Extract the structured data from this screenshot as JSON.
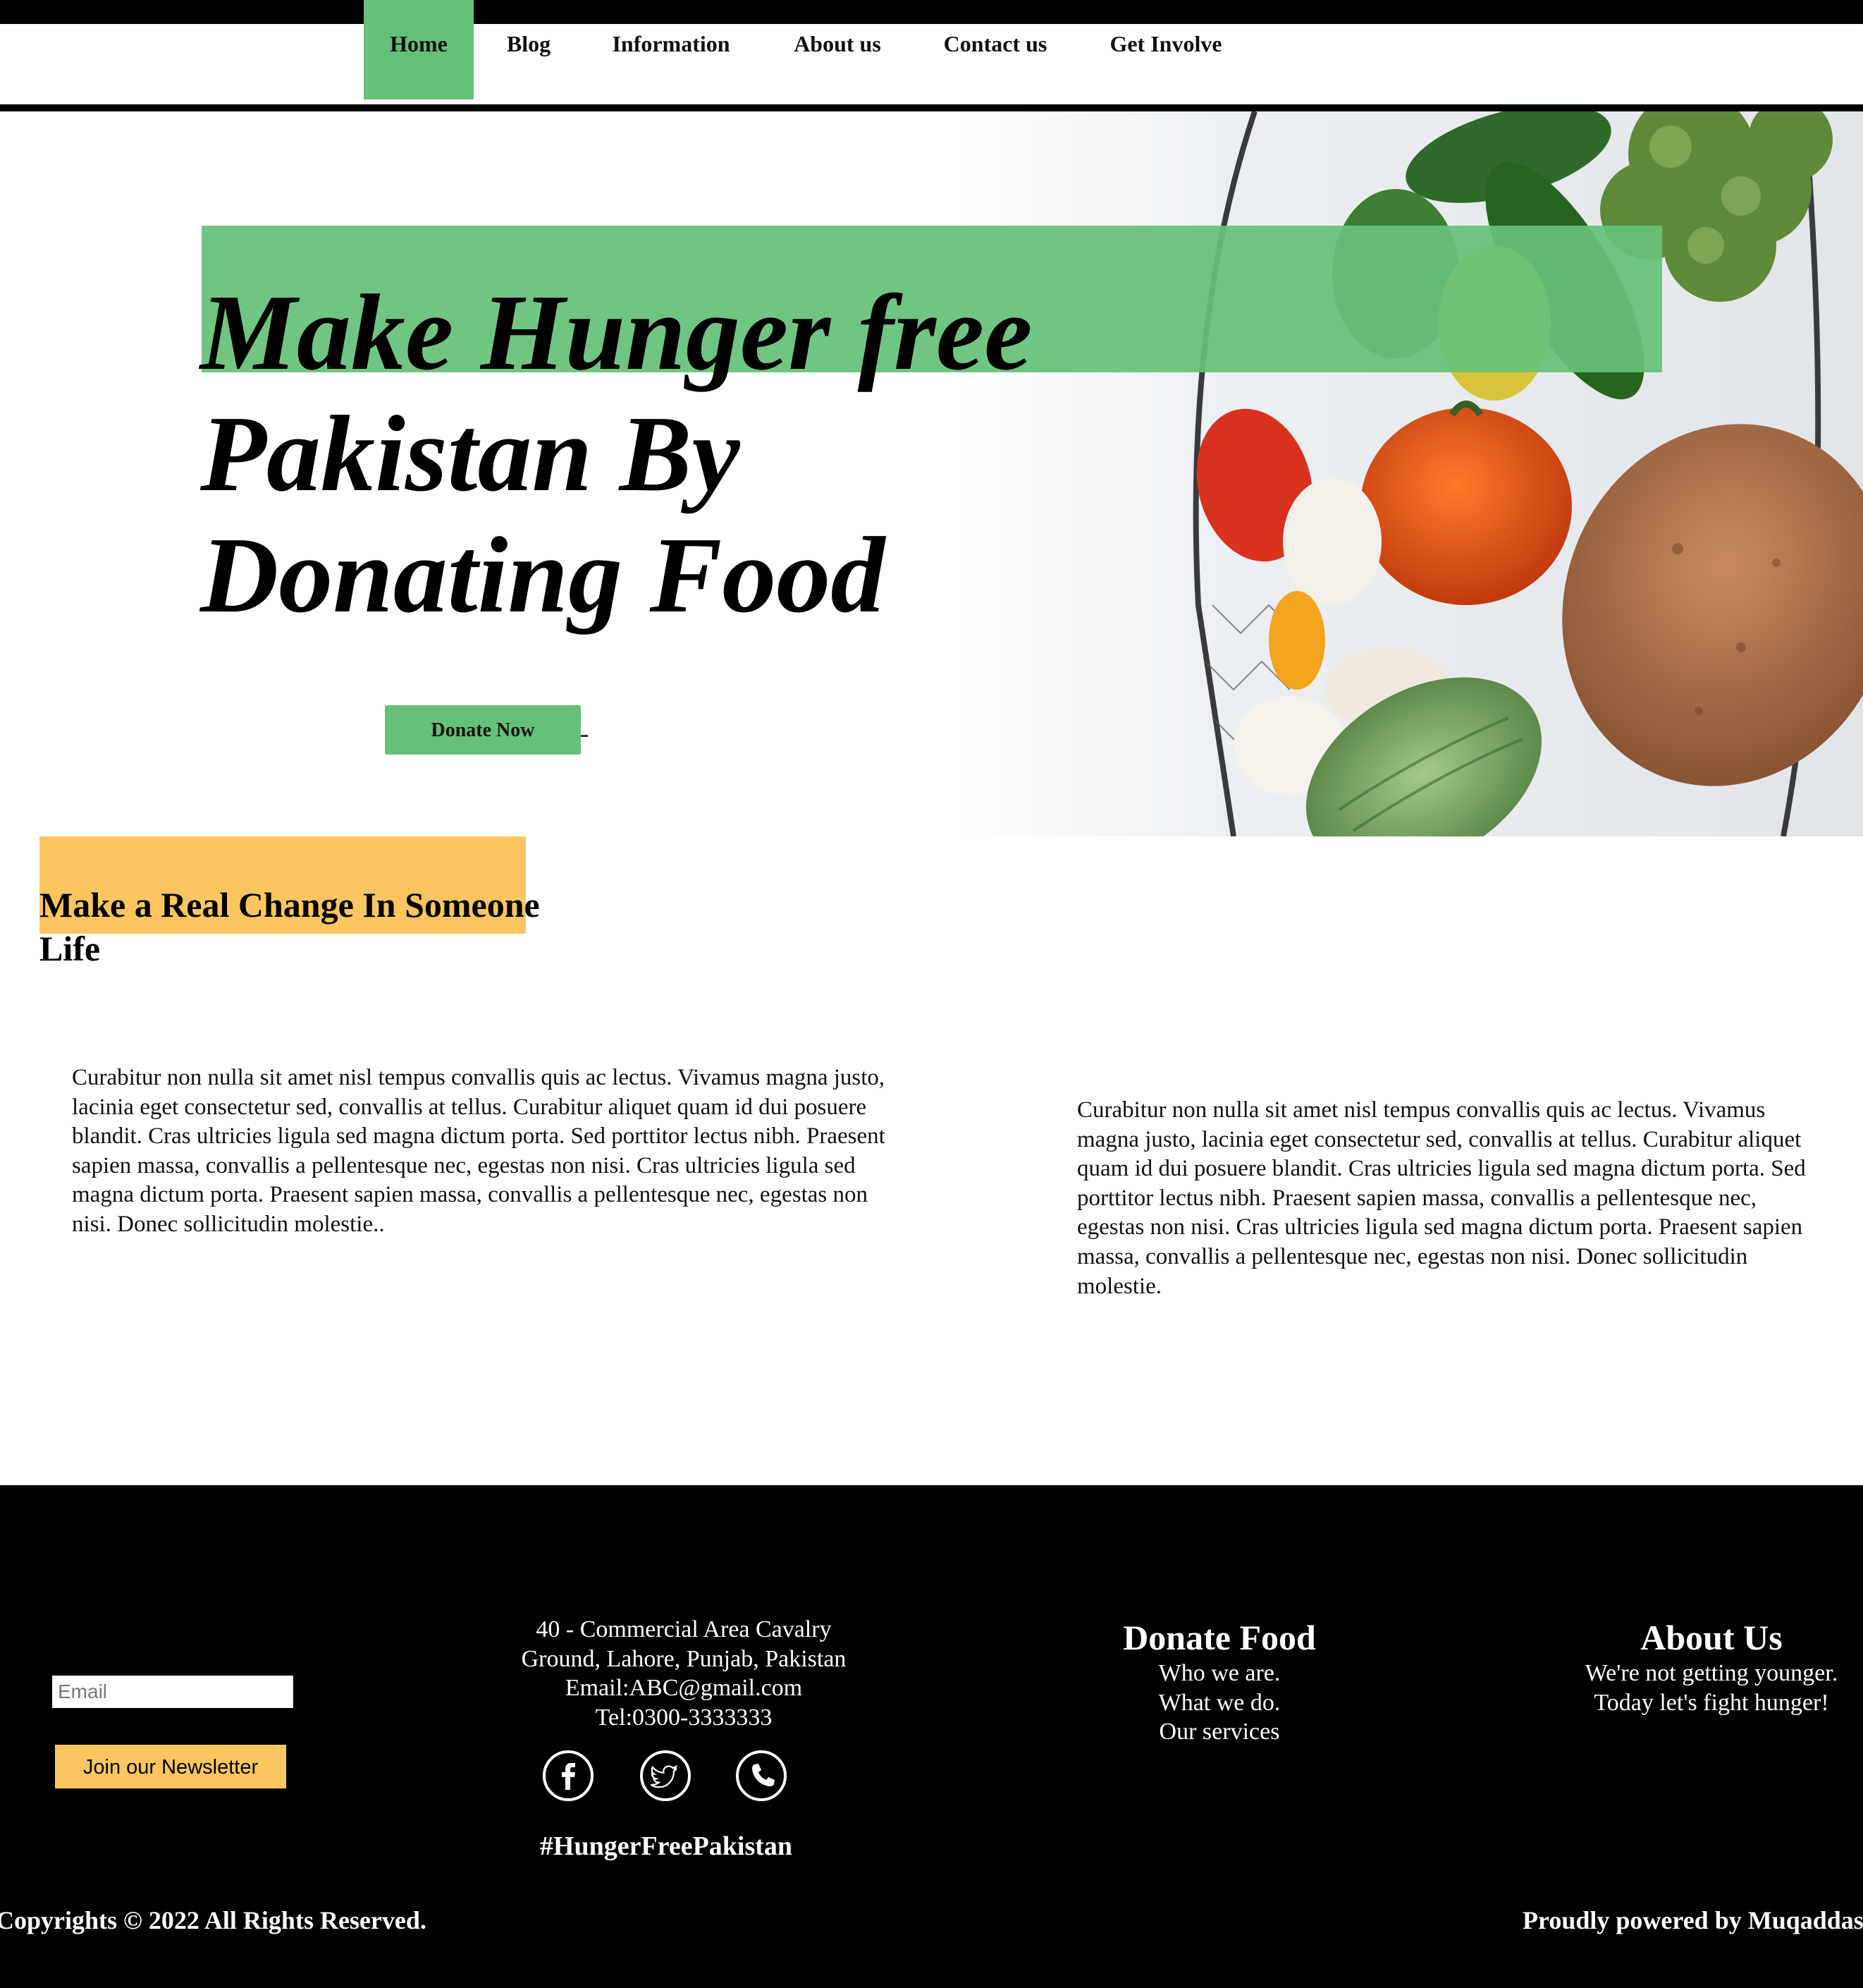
{
  "nav": {
    "items": [
      "Home",
      "Blog",
      "Information",
      "About us",
      "Contact us",
      "Get Involve"
    ],
    "active": "Home",
    "active_color": "#66c178"
  },
  "hero": {
    "title_lines": [
      "Make Hunger free",
      "Pakistan By",
      "Donating Food"
    ],
    "donate_button": "Donate Now",
    "image": "vegetables-basket-photo",
    "band_color": "#66c178"
  },
  "change": {
    "title": "Make a Real Change In Someone Life",
    "band_color": "#fbc65f",
    "para_left": "Curabitur non nulla sit amet nisl tempus convallis quis ac lectus. Vivamus magna justo, lacinia eget consectetur sed, convallis at tellus. Curabitur aliquet quam id dui posuere blandit. Cras ultricies ligula sed magna dictum porta. Sed porttitor lectus nibh. Praesent sapien massa, convallis a pellentesque nec, egestas non nisi. Cras ultricies ligula sed magna dictum porta. Praesent sapien massa, convallis a pellentesque nec, egestas non nisi. Donec sollicitudin molestie..",
    "para_right": "Curabitur non nulla sit amet nisl tempus convallis quis ac lectus. Vivamus magna justo, lacinia eget consectetur sed, convallis at tellus. Curabitur aliquet quam id dui posuere blandit. Cras ultricies ligula sed magna dictum porta. Sed porttitor lectus nibh. Praesent sapien massa, convallis a pellentesque nec, egestas non nisi. Cras ultricies ligula sed magna dictum porta. Praesent sapien massa, convallis a pellentesque nec, egestas non nisi. Donec sollicitudin molestie."
  },
  "footer": {
    "email_placeholder": "Email",
    "newsletter_button": "Join our Newsletter",
    "newsletter_color": "#fbc65f",
    "address_lines": [
      "40 - Commercial Area Cavalry",
      "Ground, Lahore, Punjab, Pakistan",
      "Email:ABC@gmail.com",
      "Tel:0300-3333333"
    ],
    "social_icons": [
      "facebook-icon",
      "twitter-icon",
      "phone-icon"
    ],
    "hashtag": "#HungerFreePakistan",
    "donate_food": {
      "title": "Donate Food",
      "links": [
        "Who we are.",
        "What we do.",
        "Our services"
      ]
    },
    "about": {
      "title": "About Us",
      "lines": [
        "We're not getting younger.",
        "Today let's fight hunger!"
      ]
    },
    "copyright": "Copyrights © 2022 All Rights Reserved.",
    "powered_by": "Proudly powered by Muqaddas"
  }
}
